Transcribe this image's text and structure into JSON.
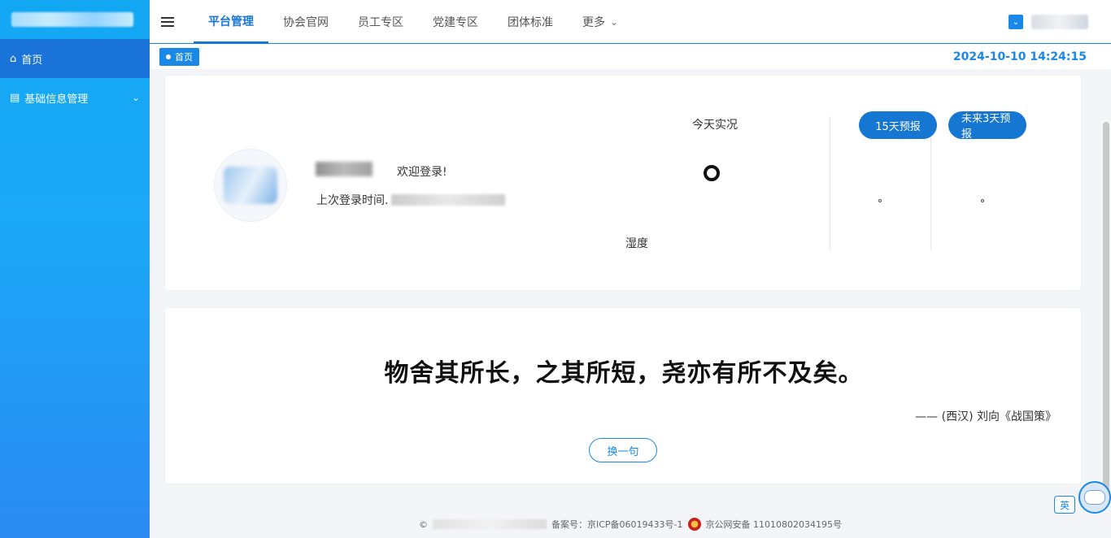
{
  "sidebar": {
    "items": [
      {
        "icon": "home-icon",
        "label": "首页",
        "active": true
      },
      {
        "icon": "database-icon",
        "label": "基础信息管理",
        "active": false
      }
    ]
  },
  "topbar": {
    "tabs": [
      {
        "label": "平台管理",
        "active": true
      },
      {
        "label": "协会官网"
      },
      {
        "label": "员工专区"
      },
      {
        "label": "党建专区"
      },
      {
        "label": "团体标准"
      },
      {
        "label": "更多"
      }
    ]
  },
  "breadcrumb": {
    "label": "首页"
  },
  "datetime": "2024-10-10 14:24:15",
  "welcome_card": {
    "welcome_text": "欢迎登录!",
    "last_login_label": "上次登录时间."
  },
  "weather": {
    "today_label": "今天实况",
    "humidity_label": "湿度",
    "forecast_15_button": "15天预报",
    "forecast_3_button": "未来3天预报"
  },
  "quote_card": {
    "quote": "物舍其所长，之其所短，尧亦有所不及矣。",
    "author": "—— (西汉) 刘向《战国策》",
    "change_button": "换一句"
  },
  "footer": {
    "copyright": "©",
    "icp": "备案号：京ICP备06019433号-1",
    "police": "京公网安备 11010802034195号"
  },
  "floating": {
    "lang_label": "英"
  }
}
